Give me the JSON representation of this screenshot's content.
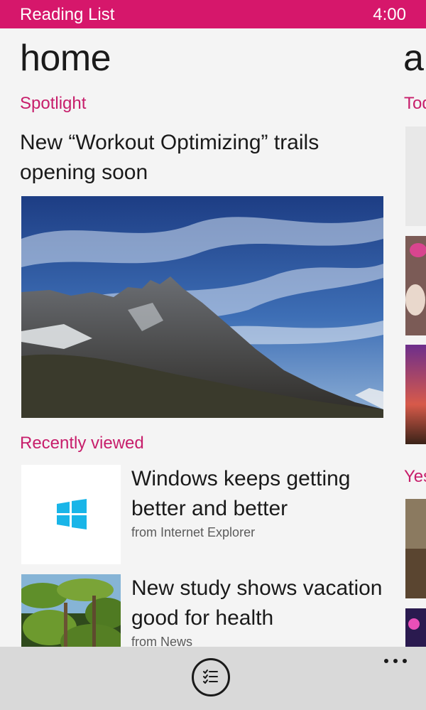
{
  "status_bar": {
    "app_title": "Reading List",
    "time": "4:00"
  },
  "panorama": {
    "title": "home",
    "next_title_peek": "al"
  },
  "spotlight": {
    "section_label": "Spotlight",
    "headline": "New “Workout Optimizing” trails opening soon",
    "image": "mountain-landscape"
  },
  "recently_viewed": {
    "section_label": "Recently viewed",
    "items": [
      {
        "title": "Windows keeps getting better and better",
        "source": "from Internet Explorer",
        "thumb": "windows-logo-icon"
      },
      {
        "title": "New study shows vacation good for health",
        "source": "from News",
        "thumb": "palm-trees-image"
      }
    ]
  },
  "peek_column": {
    "section_1": "Tod",
    "section_2": "Yes"
  },
  "app_bar": {
    "primary_icon": "checklist-icon",
    "more_icon": "ellipsis-icon"
  },
  "colors": {
    "accent": "#d6176b",
    "section": "#c71e6b",
    "background": "#f4f4f4",
    "app_bar": "#d9d9d9"
  }
}
